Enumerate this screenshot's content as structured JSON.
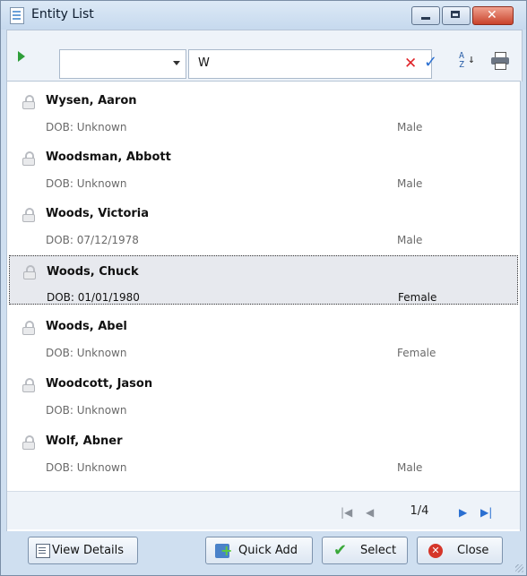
{
  "window": {
    "title": "Entity List",
    "minimize_label": "",
    "maximize_label": "",
    "close_label": "✕"
  },
  "toolbar": {
    "filter_selected": "",
    "search_value": "W",
    "clear_glyph": "✕",
    "apply_glyph": "✓"
  },
  "entities": [
    {
      "name": "Wysen, Aaron",
      "dob": "DOB: Unknown",
      "gender": "Male"
    },
    {
      "name": "Woodsman, Abbott",
      "dob": "DOB: Unknown",
      "gender": "Male"
    },
    {
      "name": "Woods, Victoria",
      "dob": "DOB: 07/12/1978",
      "gender": "Male"
    },
    {
      "name": "Woods, Chuck",
      "dob": "DOB: 01/01/1980",
      "gender": "Female"
    },
    {
      "name": "Woods, Abel",
      "dob": "DOB: Unknown",
      "gender": "Female"
    },
    {
      "name": "Woodcott, Jason",
      "dob": "DOB: Unknown",
      "gender": ""
    },
    {
      "name": "Wolf, Abner",
      "dob": "DOB: Unknown",
      "gender": "Male"
    }
  ],
  "pager": {
    "page": "1/4",
    "first": "|◀",
    "prev": "◀",
    "next": "▶",
    "last": "▶|"
  },
  "buttons": {
    "view_details": "View Details",
    "quick_add": "Quick Add",
    "select": "Select",
    "close": "Close"
  },
  "colors": {
    "title_bar": "#cfdff0",
    "selected_row": "#e7e9ee",
    "accent": "#2a6fd1",
    "close_red": "#d5362a"
  }
}
